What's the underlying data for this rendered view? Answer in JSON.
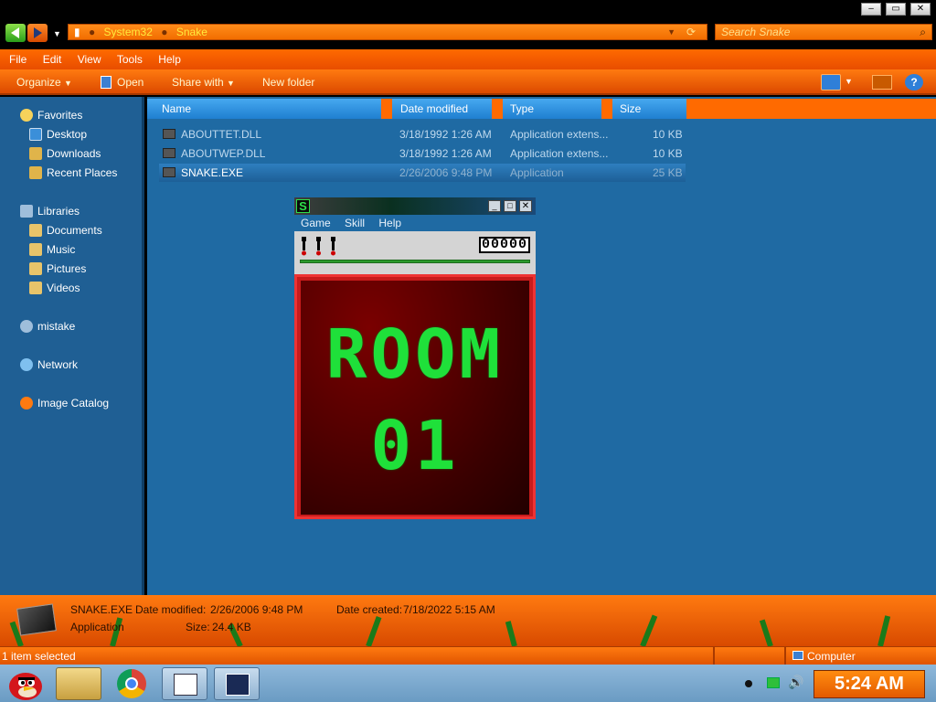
{
  "window": {
    "breadcrumb": [
      "System32",
      "Snake"
    ],
    "search_placeholder": "Search Snake",
    "controls": {
      "minimize": "–",
      "maximize": "▭",
      "close": "✕"
    }
  },
  "menubar": {
    "items": [
      "File",
      "Edit",
      "View",
      "Tools",
      "Help"
    ]
  },
  "toolbar": {
    "organize": "Organize",
    "open": "Open",
    "share": "Share with",
    "new_folder": "New folder"
  },
  "navpane": {
    "favorites": "Favorites",
    "favorites_items": [
      "Desktop",
      "Downloads",
      "Recent Places"
    ],
    "libraries": "Libraries",
    "libraries_items": [
      "Documents",
      "Music",
      "Pictures",
      "Videos"
    ],
    "homegroup": "mistake",
    "network": "Network",
    "image_catalog": "Image Catalog"
  },
  "columns": {
    "name": "Name",
    "date": "Date modified",
    "type": "Type",
    "size": "Size"
  },
  "files": [
    {
      "name": "ABOUTTET.DLL",
      "date": "3/18/1992 1:26 AM",
      "type": "Application extens...",
      "size": "10 KB"
    },
    {
      "name": "ABOUTWEP.DLL",
      "date": "3/18/1992 1:26 AM",
      "type": "Application extens...",
      "size": "10 KB"
    },
    {
      "name": "SNAKE.EXE",
      "date": "2/26/2006 9:48 PM",
      "type": "Application",
      "size": "25 KB"
    }
  ],
  "snake": {
    "icon_letter": "S",
    "menu": [
      "Game",
      "Skill",
      "Help"
    ],
    "score": "00000",
    "room_line1": "ROOM",
    "room_line2": "01",
    "lives": 3
  },
  "details": {
    "filename": "SNAKE.EXE",
    "date_modified_label": "Date modified:",
    "date_modified": "2/26/2006 9:48 PM",
    "date_created_label": "Date created:",
    "date_created": "7/18/2022 5:15 AM",
    "type": "Application",
    "size_label": "Size:",
    "size": "24.4 KB"
  },
  "statusbar": {
    "selection": "1 item selected",
    "location": "Computer"
  },
  "taskbar": {
    "clock": "5:24 AM"
  },
  "colors": {
    "accent": "#ff6a00",
    "content_bg": "#1f6aa3",
    "snake_green": "#1fe03a",
    "arena_red": "#c81b1b"
  }
}
